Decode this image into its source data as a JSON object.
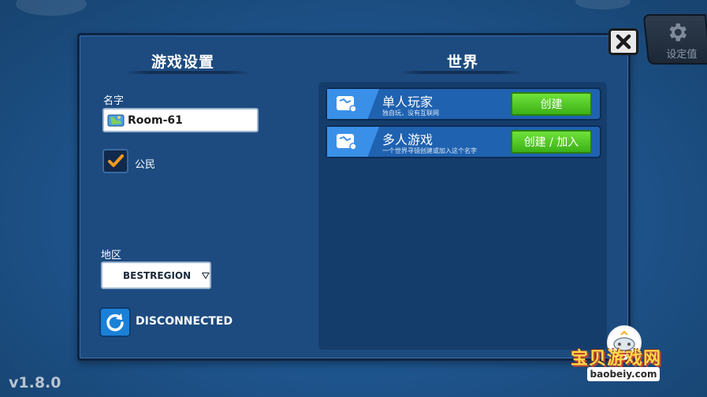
{
  "settings_tab": {
    "icon": "gear-icon",
    "label": "设定值"
  },
  "close_button": {
    "icon": "close-icon"
  },
  "left_panel": {
    "title": "游戏设置",
    "name_label": "名字",
    "name_value": "Room-61",
    "public_checkbox": {
      "checked": true,
      "label": "公民"
    },
    "region_label": "地区",
    "region_value": "BESTREGION",
    "connection_status": "DISCONNECTED"
  },
  "right_panel": {
    "title": "世界",
    "worlds": [
      {
        "title": "单人玩家",
        "description": "独自玩，没有互联网",
        "button": "创建"
      },
      {
        "title": "多人游戏",
        "description": "一个世界寻镜创建或加入这个名字",
        "button": "创建 / 加入"
      }
    ]
  },
  "version": "v1.8.0",
  "watermark": {
    "text": "宝贝游戏网",
    "url": "baobeiy.com"
  },
  "colors": {
    "panel": "#1d4b80",
    "button_green": "#4cc623",
    "accent_blue": "#1a80d8",
    "checkmark": "#f39a1e"
  }
}
